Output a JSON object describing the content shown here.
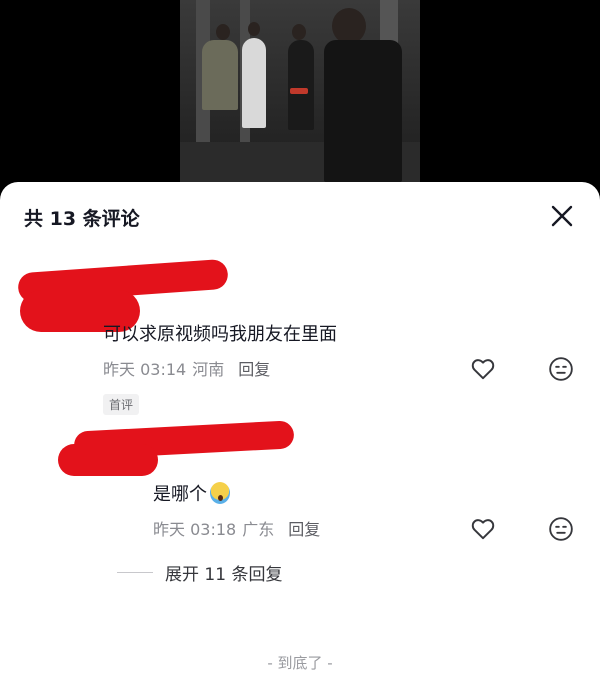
{
  "header": {
    "title": "共 13 条评论",
    "close_icon": "close-icon"
  },
  "comments": [
    {
      "text": "可以求原视频吗我朋友在里面",
      "time": "昨天 03:14",
      "location": "河南",
      "reply_label": "回复",
      "tag": "首评"
    },
    {
      "text": "是哪个",
      "emoji": "screaming-face-emoji",
      "time": "昨天 03:18",
      "location": "广东",
      "reply_label": "回复"
    }
  ],
  "expand_replies": "展开 11 条回复",
  "footer": "- 到底了 -",
  "colors": {
    "redaction": "#e3121b",
    "text_primary": "#161823",
    "text_secondary": "#8a8b91"
  }
}
